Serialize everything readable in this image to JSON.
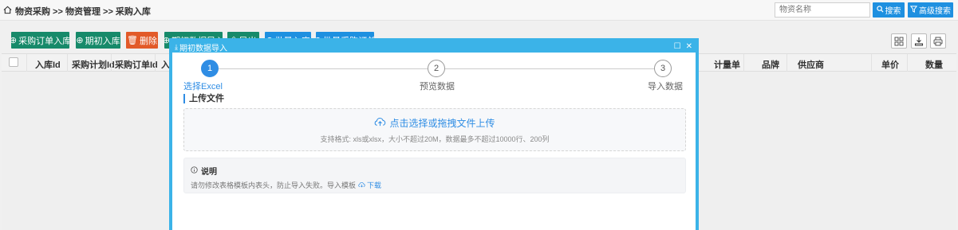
{
  "breadcrumb": "物资采购 >> 物资管理 >> 采购入库",
  "search": {
    "placeholder": "物资名称",
    "search_label": "搜索",
    "advanced_label": "高级搜索"
  },
  "toolbar": {
    "buttons": [
      {
        "label": "采购订单入库"
      },
      {
        "label": "期初入库"
      },
      {
        "label": "删除"
      },
      {
        "label": "期初数据导入"
      },
      {
        "label": "导出"
      },
      {
        "label": "批量入库"
      },
      {
        "label": "批量采购订单"
      }
    ]
  },
  "table": {
    "columns": [
      "入库Id",
      "采购计划Id",
      "采购订单Id",
      "入库",
      "计量单",
      "品牌",
      "供应商",
      "单价",
      "数量"
    ]
  },
  "modal": {
    "title": "期初数据导入",
    "steps": [
      {
        "num": "1",
        "label": "选择Excel"
      },
      {
        "num": "2",
        "label": "预览数据"
      },
      {
        "num": "3",
        "label": "导入数据"
      }
    ],
    "section_title": "上传文件",
    "upload_label": "点击选择或拖拽文件上传",
    "upload_hint": "支持格式: xls或xlsx，大小不超过20M，数据最多不超过10000行、200列",
    "note_title": "说明",
    "note_text": "请勿修改表格模板内表头，防止导入失败。导入模板",
    "download_label": "下载"
  },
  "colors": {
    "accent": "#2f8de4",
    "modal_border": "#3bb3e8",
    "green": "#178a6a",
    "orange": "#e25a29"
  }
}
